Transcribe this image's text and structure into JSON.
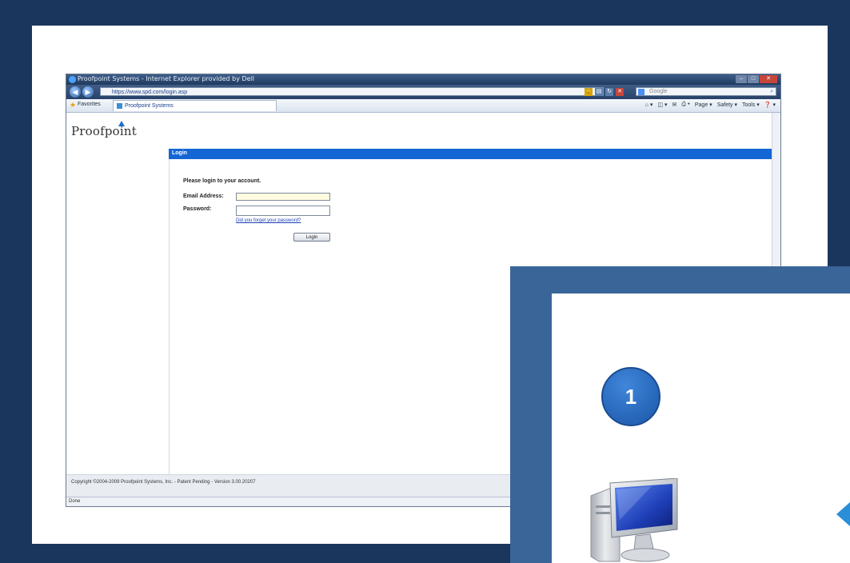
{
  "browser": {
    "window_title": "Proofpoint Systems - Internet Explorer provided by Dell",
    "address": "https://www.spd.com/login.asp",
    "search_placeholder": "Google",
    "favorites_label": "Favorites",
    "tab_label": "Proofpoint Systems",
    "command_items": [
      "Page ▾",
      "Safety ▾",
      "Tools ▾",
      "❓ ▾"
    ],
    "status_text": "Done"
  },
  "page": {
    "logo_text": "Proofpoint",
    "section_title": "Login",
    "prompt": "Please login to your account.",
    "email_label": "Email Address:",
    "password_label": "Password:",
    "forgot_link": "Did you forget your password?",
    "login_button": "Login",
    "copyright": "Copyright ©2004-2009 Proofpoint Systems, Inc. - Patent Pending - Version 3.00.20207"
  },
  "overlay": {
    "step_number": "1"
  },
  "colors": {
    "frame": "#1b365d",
    "overlay": "#3a6599",
    "header_bar": "#1466d4",
    "badge": "#2a6dc2"
  }
}
